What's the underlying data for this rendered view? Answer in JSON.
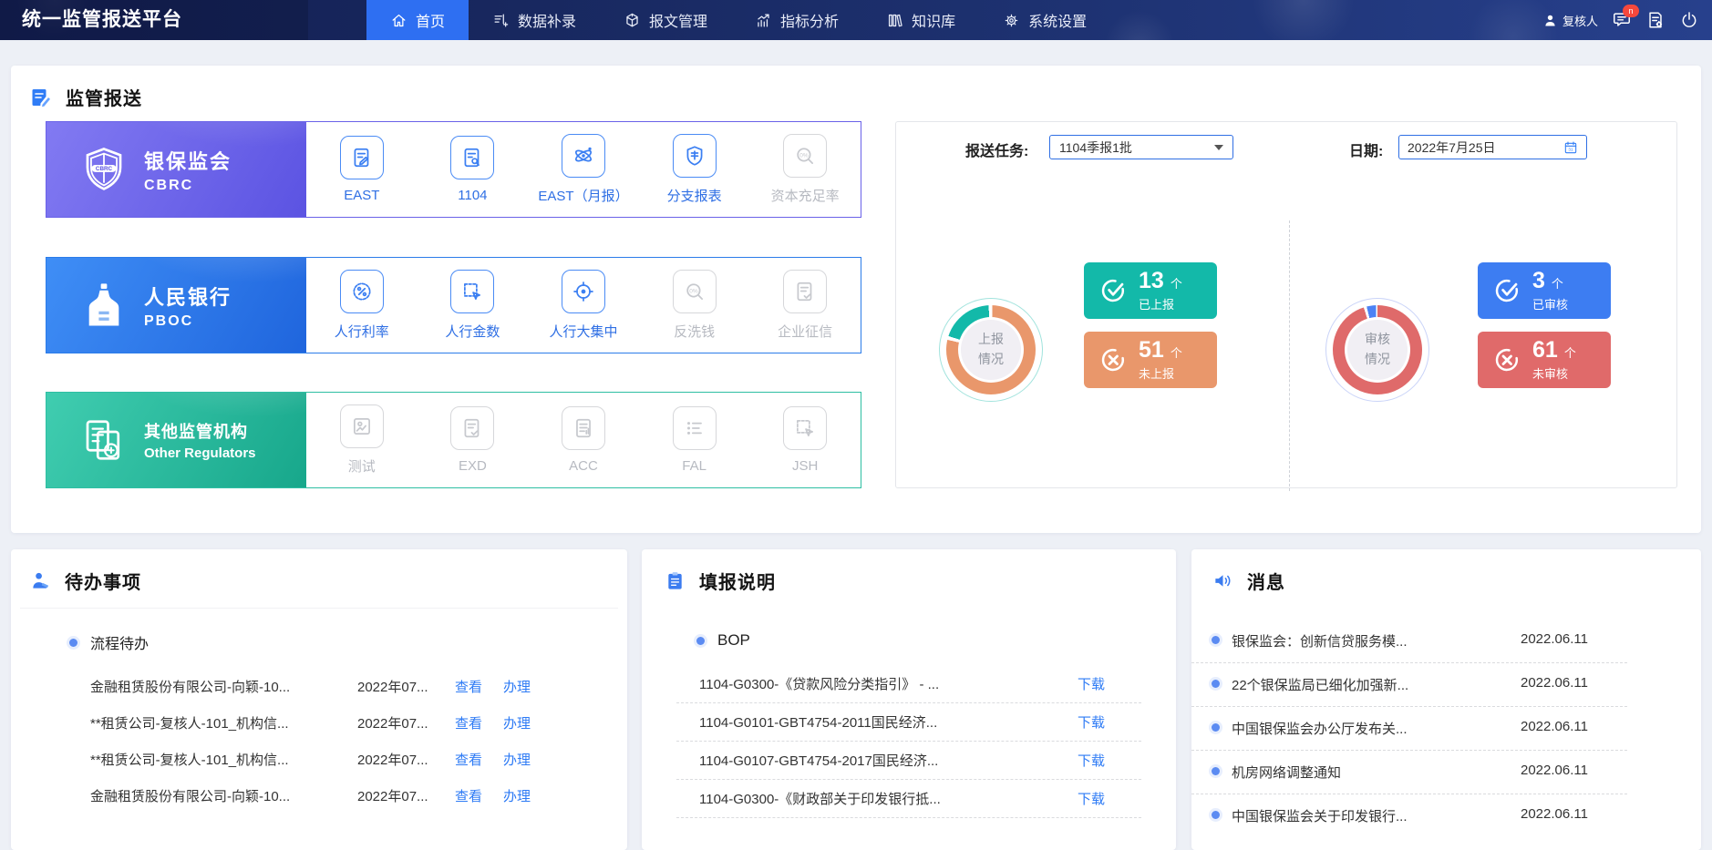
{
  "app": {
    "title": "统一监管报送平台"
  },
  "nav": {
    "items": [
      {
        "label": "首页",
        "active": true
      },
      {
        "label": "数据补录",
        "active": false
      },
      {
        "label": "报文管理",
        "active": false
      },
      {
        "label": "指标分析",
        "active": false
      },
      {
        "label": "知识库",
        "active": false
      },
      {
        "label": "系统设置",
        "active": false
      }
    ]
  },
  "user": {
    "name": "复核人",
    "badge": "n"
  },
  "report": {
    "title": "监管报送",
    "regulators": [
      {
        "name": "银保监会",
        "sub": "CBRC",
        "accent": "#6a62e8",
        "items": [
          {
            "label": "EAST",
            "enabled": true
          },
          {
            "label": "1104",
            "enabled": true
          },
          {
            "label": "EAST（月报）",
            "enabled": true
          },
          {
            "label": "分支报表",
            "enabled": true
          },
          {
            "label": "资本充足率",
            "enabled": false
          }
        ]
      },
      {
        "name": "人民银行",
        "sub": "PBOC",
        "accent": "#2b7ce9",
        "items": [
          {
            "label": "人行利率",
            "enabled": true
          },
          {
            "label": "人行金数",
            "enabled": true
          },
          {
            "label": "人行大集中",
            "enabled": true
          },
          {
            "label": "反洗钱",
            "enabled": false
          },
          {
            "label": "企业征信",
            "enabled": false
          }
        ]
      },
      {
        "name": "其他监管机构",
        "sub": "Other Regulators",
        "accent": "#2ebfa3",
        "items": [
          {
            "label": "测试",
            "enabled": false
          },
          {
            "label": "EXD",
            "enabled": false
          },
          {
            "label": "ACC",
            "enabled": false
          },
          {
            "label": "FAL",
            "enabled": false
          },
          {
            "label": "JSH",
            "enabled": false
          }
        ]
      }
    ]
  },
  "task": {
    "task_label": "报送任务:",
    "task_value": "1104季报1批",
    "date_label": "日期:",
    "date_value": "2022年7月25日",
    "groups": [
      {
        "center": [
          "上报",
          "情况"
        ],
        "stats": [
          {
            "value": "13",
            "unit": "个",
            "label": "已上报",
            "color": "#13b9a9"
          },
          {
            "value": "51",
            "unit": "个",
            "label": "未上报",
            "color": "#e9976b"
          }
        ]
      },
      {
        "center": [
          "审核",
          "情况"
        ],
        "stats": [
          {
            "value": "3",
            "unit": "个",
            "label": "已审核",
            "color": "#3d7df2"
          },
          {
            "value": "61",
            "unit": "个",
            "label": "未审核",
            "color": "#e06a6a"
          }
        ]
      }
    ]
  },
  "chart_data": [
    {
      "type": "pie",
      "title": "上报情况",
      "labels": [
        "已上报",
        "未上报"
      ],
      "values": [
        13,
        51
      ],
      "colors": [
        "#13b9a9",
        "#e9976b"
      ],
      "legend_position": "none"
    },
    {
      "type": "pie",
      "title": "审核情况",
      "labels": [
        "已审核",
        "未审核"
      ],
      "values": [
        3,
        61
      ],
      "colors": [
        "#4b82f5",
        "#df6a6a"
      ],
      "legend_position": "none"
    }
  ],
  "todo": {
    "title": "待办事项",
    "group": "流程待办",
    "view_label": "查看",
    "handle_label": "办理",
    "items": [
      {
        "name": "金融租赁股份有限公司-向颖-10...",
        "date": "2022年07..."
      },
      {
        "name": "**租赁公司-复核人-101_机构信...",
        "date": "2022年07..."
      },
      {
        "name": "**租赁公司-复核人-101_机构信...",
        "date": "2022年07..."
      },
      {
        "name": "金融租赁股份有限公司-向颖-10...",
        "date": "2022年07..."
      }
    ]
  },
  "guide": {
    "title": "填报说明",
    "group": "BOP",
    "download_label": "下载",
    "items": [
      {
        "text": "1104-G0300-《贷款风险分类指引》 - ..."
      },
      {
        "text": "1104-G0101-GBT4754-2011国民经济..."
      },
      {
        "text": "1104-G0107-GBT4754-2017国民经济..."
      },
      {
        "text": "1104-G0300-《财政部关于印发银行抵..."
      }
    ]
  },
  "messages": {
    "title": "消息",
    "items": [
      {
        "text": "银保监会：创新信贷服务模...",
        "date": "2022.06.11"
      },
      {
        "text": "22个银保监局已细化加强新...",
        "date": "2022.06.11"
      },
      {
        "text": "中国银保监会办公厅发布关...",
        "date": "2022.06.11"
      },
      {
        "text": "机房网络调整通知",
        "date": "2022.06.11"
      },
      {
        "text": "中国银保监会关于印发银行...",
        "date": "2022.06.11"
      }
    ]
  }
}
